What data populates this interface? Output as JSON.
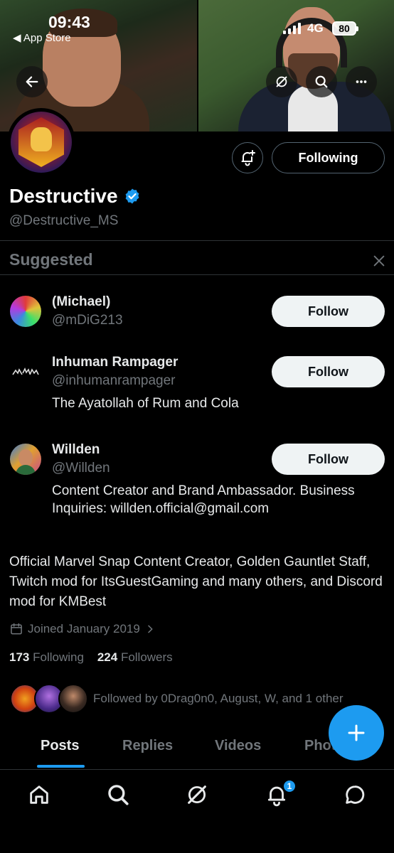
{
  "status_bar": {
    "time": "09:43",
    "back_app": "◀ App Store",
    "network": "4G",
    "battery": "80"
  },
  "profile": {
    "display_name": "Destructive",
    "handle": "@Destructive_MS",
    "following_button": "Following",
    "verified_icon": "verified-badge-icon",
    "bio": "Official Marvel Snap Content Creator, Golden Gauntlet Staff, Twitch mod for ItsGuestGaming and many others, and Discord mod for KMBest",
    "joined": "Joined January 2019",
    "following_count": "173",
    "following_label": "Following",
    "followers_count": "224",
    "followers_label": "Followers",
    "followed_by": "Followed by 0Drag0n0, August, W, and 1 other"
  },
  "suggested": {
    "title": "Suggested",
    "items": [
      {
        "name": "(Michael)",
        "handle": "@mDiG213",
        "bio": "",
        "button": "Follow"
      },
      {
        "name": "Inhuman Rampager",
        "handle": "@inhumanrampager",
        "bio": "The Ayatollah of Rum and Cola",
        "button": "Follow"
      },
      {
        "name": "Willden",
        "handle": "@Willden",
        "bio": "Content Creator and Brand Ambassador. Business Inquiries: willden.official@gmail.com",
        "button": "Follow"
      }
    ]
  },
  "tabs": [
    {
      "label": "Posts",
      "active": true
    },
    {
      "label": "Replies",
      "active": false
    },
    {
      "label": "Videos",
      "active": false
    },
    {
      "label": "Photos",
      "active": false
    }
  ],
  "nav": {
    "notifications_badge": "1"
  },
  "colors": {
    "accent": "#1d9bf0",
    "background": "#000000",
    "muted": "#71767b"
  }
}
